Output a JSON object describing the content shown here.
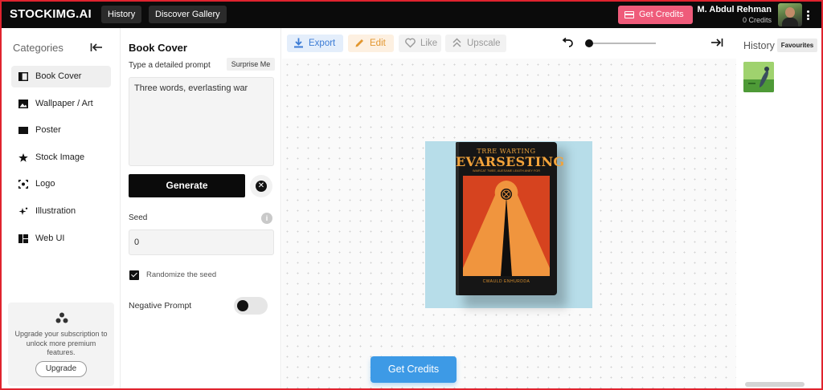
{
  "app": {
    "logo": "STOCKIMG.AI",
    "nav": [
      "History",
      "Discover Gallery"
    ],
    "get_credits": "Get Credits",
    "user_name": "M. Abdul Rehman",
    "user_credits": "0 Credits"
  },
  "sidebar": {
    "title": "Categories",
    "items": [
      {
        "label": "Book Cover",
        "icon": "book-icon"
      },
      {
        "label": "Wallpaper / Art",
        "icon": "image-icon"
      },
      {
        "label": "Poster",
        "icon": "poster-icon"
      },
      {
        "label": "Stock Image",
        "icon": "star-icon"
      },
      {
        "label": "Logo",
        "icon": "logo-icon"
      },
      {
        "label": "Illustration",
        "icon": "sparkle-icon"
      },
      {
        "label": "Web UI",
        "icon": "grid-icon"
      }
    ],
    "upgrade": {
      "text": "Upgrade your subscription to unlock more premium features.",
      "button": "Upgrade"
    }
  },
  "form": {
    "title": "Book Cover",
    "prompt_label": "Type a detailed prompt",
    "surprise": "Surprise Me",
    "prompt_value": "Three words, everlasting war",
    "generate": "Generate",
    "seed_label": "Seed",
    "seed_value": "0",
    "randomize_label": "Randomize the seed",
    "randomize_checked": true,
    "negative_label": "Negative Prompt",
    "negative_enabled": false
  },
  "toolbar": {
    "export": "Export",
    "edit": "Edit",
    "like": "Like",
    "upscale": "Upscale"
  },
  "canvas": {
    "book_title_line1": "TRRE WARTING",
    "book_title_line2": "EVARSESTING",
    "book_subtitle": "WAIRCAT TWEE, AUESAME LEAITH ANEY FOR",
    "book_author": "CWAULD ENHURDDA",
    "get_credits": "Get Credits"
  },
  "history": {
    "title": "History",
    "favourites": "Favourites"
  },
  "colors": {
    "accent_pink": "#ef5b7a",
    "accent_blue": "#3d9ae6",
    "export_blue": "#3b7bd5",
    "edit_orange": "#e2962f"
  }
}
